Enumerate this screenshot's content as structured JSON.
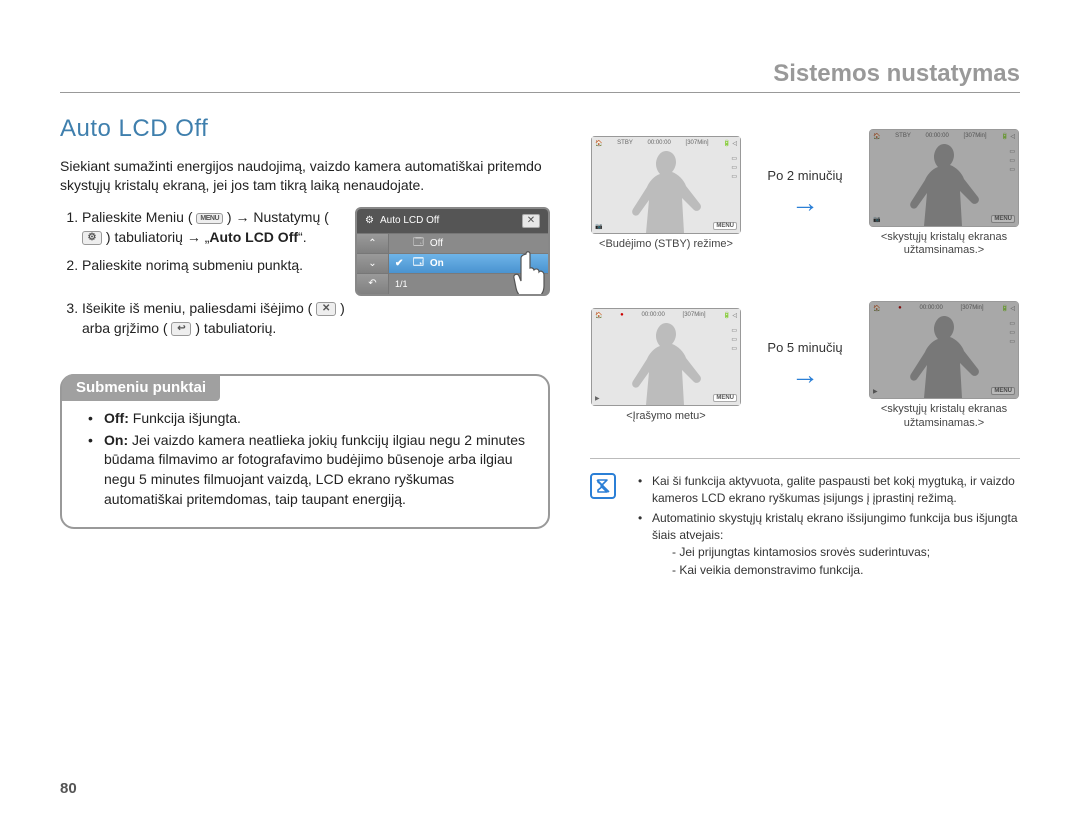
{
  "chapter": "Sistemos nustatymas",
  "section_title": "Auto LCD Off",
  "intro": "Siekiant sumažinti energijos naudojimą, vaizdo kamera automatiškai pritemdo skystųjų kristalų ekraną, jei jos tam tikrą laiką nenaudojate.",
  "steps": {
    "s1a": "Palieskite Meniu (",
    "s1b": ") → Nustatymų (",
    "s1c": ") tabuliatorių → „",
    "s1d": "Auto LCD Off",
    "s1e": "“.",
    "s2": "Palieskite norimą submeniu punktą.",
    "s3a": "Išeikite iš meniu, paliesdami išėjimo (",
    "s3b": ") arba grįžimo (",
    "s3c": ") tabuliatorių."
  },
  "menu_mockup": {
    "title": "Auto LCD Off",
    "off_label": "Off",
    "on_label": "On",
    "page": "1/1"
  },
  "submenu": {
    "heading": "Submeniu punktai",
    "off_label": "Off:",
    "off_text": " Funkcija išjungta.",
    "on_label": "On:",
    "on_text": " Jei vaizdo kamera neatlieka jokių funkcijų ilgiau negu 2 minutes būdama filmavimo ar fotografavimo budėjimo būsenoje arba ilgiau negu 5 minutes filmuojant vaizdą, LCD ekrano ryškumas automatiškai pritemdomas, taip taupant energiją."
  },
  "right_states": {
    "arrow1": "Po 2 minučių",
    "arrow2": "Po 5 minučių",
    "caption_tl": "<Budėjimo (STBY) režime>",
    "caption_tr": "<skystųjų kristalų ekranas užtamsinamas.>",
    "caption_bl": "<Įrašymo metu>",
    "caption_br": "<skystųjų kristalų ekranas užtamsinamas.>",
    "osd": {
      "stby": "STBY",
      "rec_time": "00:00:00",
      "remaining": "[307Min]",
      "menu": "MENU"
    }
  },
  "notes": {
    "n1": "Kai ši funkcija aktyvuota, galite paspausti bet kokį mygtuką, ir vaizdo kameros LCD ekrano ryškumas įsijungs į įprastinį režimą.",
    "n2": "Automatinio skystųjų kristalų ekrano išsijungimo funkcija bus išjungta šiais atvejais:",
    "n2a": "Jei prijungtas kintamosios srovės suderintuvas;",
    "n2b": "Kai veikia demonstravimo funkcija."
  },
  "page_number": "80"
}
